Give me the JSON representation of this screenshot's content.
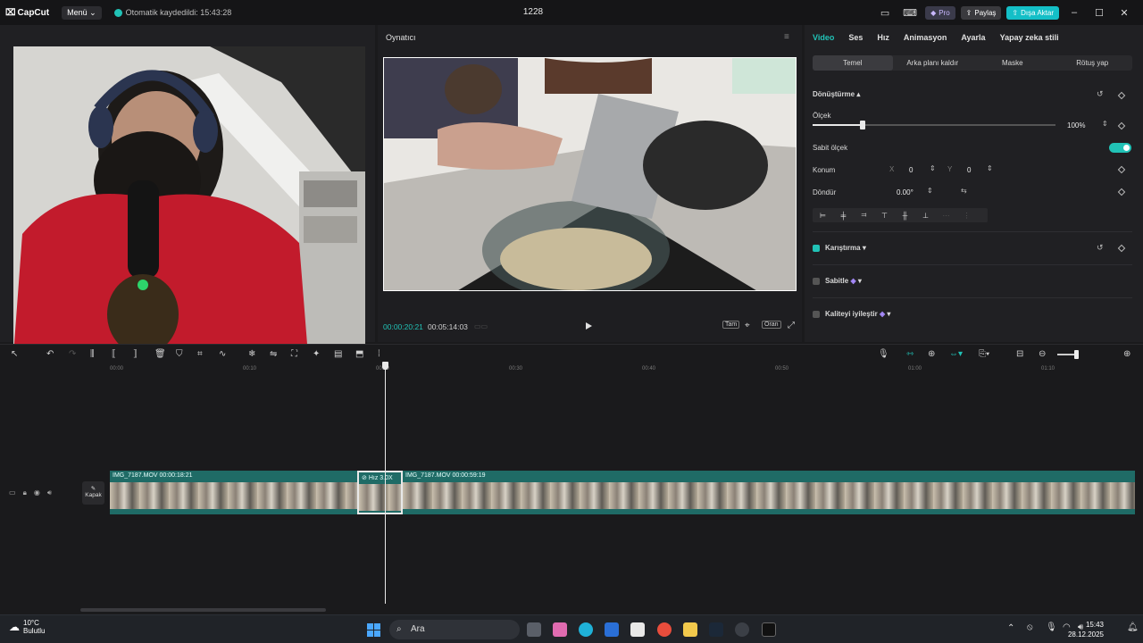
{
  "titlebar": {
    "app_name": "CapCut",
    "menu_label": "Menü",
    "autosave_text": "Otomatik kaydedildi: 15:43:28",
    "project_title": "1228",
    "pro_label": "Pro",
    "share_label": "Paylaş",
    "export_label": "Dışa Aktar"
  },
  "player": {
    "title": "Oynatıcı",
    "current_time": "00:00:20:21",
    "total_time": "00:05:14:03",
    "full_label": "Tam",
    "ratio_label": "Oran"
  },
  "inspector": {
    "tabs": [
      "Video",
      "Ses",
      "Hız",
      "Animasyon",
      "Ayarla",
      "Yapay zeka stili"
    ],
    "subtabs": [
      "Temel",
      "Arka planı kaldır",
      "Maske",
      "Rötuş yap"
    ],
    "transform_title": "Dönüştürme",
    "scale_label": "Ölçek",
    "scale_value": "100%",
    "uniform_scale_label": "Sabit ölçek",
    "position_label": "Konum",
    "pos_x_label": "X",
    "pos_x_value": "0",
    "pos_y_label": "Y",
    "pos_y_value": "0",
    "rotate_label": "Döndür",
    "rotate_value": "0.00°",
    "blend_label": "Karıştırma",
    "stabilize_label": "Sabitle",
    "enhance_label": "Kaliteyi iyileştir"
  },
  "timeline": {
    "ruler_ticks": [
      "00:00",
      "00:10",
      "00:20",
      "00:30",
      "00:40",
      "00:50",
      "01:00",
      "01:10"
    ],
    "cover_label": "Kapak",
    "clips": [
      {
        "label": "IMG_7187.MOV   00:00:18:21"
      },
      {
        "label": "Hız 3.0X"
      },
      {
        "label": "IMG_7187.MOV   00:00:59:19"
      }
    ]
  },
  "taskbar": {
    "weather_temp": "10°C",
    "weather_desc": "Bulutlu",
    "search_placeholder": "Ara",
    "time": "15:43",
    "date": "28.12.2025"
  },
  "colors": {
    "accent": "#21c2b6",
    "clip": "#1f6b66"
  }
}
